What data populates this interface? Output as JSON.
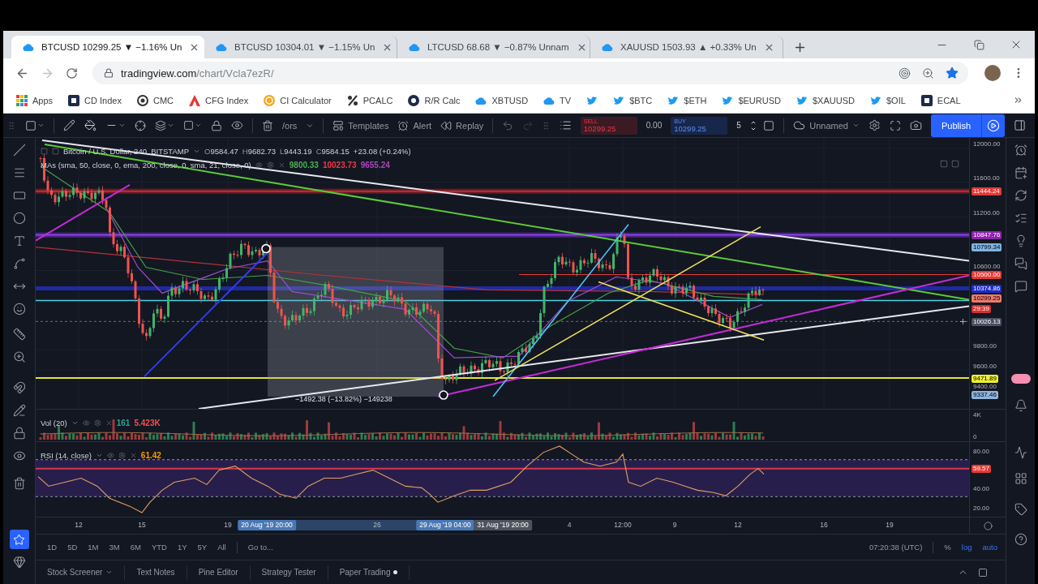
{
  "browser": {
    "tabs": [
      {
        "title": "BTCUSD 10299.25 ▼ −1.16% Un",
        "selected": true
      },
      {
        "title": "BTCUSD 10304.01 ▼ −1.15% Un",
        "selected": false
      },
      {
        "title": "LTCUSD 68.68 ▼ −0.87% Unnam",
        "selected": false
      },
      {
        "title": "XAUUSD 1503.93 ▲ +0.33% Un",
        "selected": false
      }
    ],
    "address": {
      "domain": "tradingview.com",
      "path": "/chart/Vcla7ezR/"
    },
    "bookmarks": [
      {
        "kind": "apps",
        "label": "Apps"
      },
      {
        "kind": "tile",
        "label": "CD Index"
      },
      {
        "kind": "ring",
        "label": "CMC"
      },
      {
        "kind": "triangle",
        "label": "CFG Index"
      },
      {
        "kind": "coin",
        "label": "CI Calculator"
      },
      {
        "kind": "percent",
        "label": "PCALC"
      },
      {
        "kind": "disc",
        "label": "R/R Calc"
      },
      {
        "kind": "cloud",
        "label": "XBTUSD"
      },
      {
        "kind": "cloud",
        "label": "TV"
      },
      {
        "kind": "bird"
      },
      {
        "kind": "bird",
        "label": "$BTC"
      },
      {
        "kind": "bird",
        "label": "$ETH"
      },
      {
        "kind": "bird",
        "label": "$EURUSD"
      },
      {
        "kind": "bird",
        "label": "$XAUUSD"
      },
      {
        "kind": "bird",
        "label": "$OIL"
      },
      {
        "kind": "tile",
        "label": "ECAL"
      }
    ]
  },
  "toolbar": {
    "indicators": "/ors",
    "templates": "Templates",
    "alert": "Alert",
    "replay": "Replay",
    "sell": {
      "label": "SELL",
      "price": "10299.25"
    },
    "spread": "0.00",
    "buy": {
      "label": "BUY",
      "price": "10299.25"
    },
    "quantity": "5",
    "layout": "Unnamed",
    "publish": "Publish"
  },
  "chart": {
    "legend": {
      "symbol": "Bitcoin / U.S. Dollar, 240, BITSTAMP",
      "ohlc": [
        {
          "key": "O",
          "value": "9584.47"
        },
        {
          "key": "H",
          "value": "9682.73"
        },
        {
          "key": "L",
          "value": "9443.19"
        },
        {
          "key": "C",
          "value": "9584.15"
        }
      ],
      "change": "+23.08 (+0.24%)"
    },
    "main_study": {
      "name": "MAs (sma, 50, close, 0, ema, 200, close, 0, sma, 21, close, 0)",
      "values": [
        {
          "text": "9800.33",
          "color": "#4caf50"
        },
        {
          "text": "10023.73",
          "color": "#f23645"
        },
        {
          "text": "9655.24",
          "color": "#ab47bc"
        }
      ]
    },
    "measure": "−1492.38 (−13.82%) −149238",
    "price_axis": {
      "ticks": [
        "12000.00",
        "11600.00",
        "11200.00",
        "10600.00",
        "9800.00",
        "9600.00",
        "9400.00"
      ],
      "markers": [
        {
          "label": "11444.24",
          "color": "#e53935"
        },
        {
          "label": "10847.76",
          "color": "#8e24aa"
        },
        {
          "label": "10799.34",
          "color": "#7fb3e0"
        },
        {
          "label": "10500.00",
          "color": "#e53935"
        },
        {
          "label": "10374.86",
          "color": "#1e2bc8"
        },
        {
          "label": "10299.25",
          "color": "#ef7a6a"
        },
        {
          "label": "29:39",
          "color": "#d32f2f"
        },
        {
          "label": "10026.13",
          "color": "#4a5163"
        },
        {
          "label": "9471.89",
          "color": "#f0f032"
        },
        {
          "label": "9337.46",
          "color": "#8fb6de"
        }
      ]
    },
    "volume": {
      "name": "Vol (20)",
      "values": [
        {
          "text": "161",
          "color": "#26a69a"
        },
        {
          "text": "5.423K",
          "color": "#ef5350"
        }
      ],
      "axis": [
        "4K",
        "0"
      ]
    },
    "rsi": {
      "name": "RSI (14, close)",
      "values": [
        {
          "text": "61.42",
          "color": "#ff9800"
        }
      ],
      "axis": {
        "ticks": [
          "80.00",
          "40.00",
          "20.00"
        ],
        "markers": [
          {
            "label": "59.57",
            "color": "#e53935"
          }
        ]
      }
    },
    "time_axis": [
      {
        "label": "12",
        "kind": "tick"
      },
      {
        "label": "15",
        "kind": "tick"
      },
      {
        "label": "19",
        "kind": "tick"
      },
      {
        "label": "20 Aug '19 20:00",
        "kind": "range"
      },
      {
        "label": "26",
        "kind": "tick"
      },
      {
        "label": "29 Aug '19 04:00",
        "kind": "range"
      },
      {
        "label": "31 Aug '19 20:00",
        "kind": "cursor"
      },
      {
        "label": "4",
        "kind": "tick"
      },
      {
        "label": "12:00",
        "kind": "tick"
      },
      {
        "label": "9",
        "kind": "tick"
      },
      {
        "label": "12",
        "kind": "tick"
      },
      {
        "label": "16",
        "kind": "tick"
      },
      {
        "label": "19",
        "kind": "tick"
      }
    ],
    "range_bar": {
      "ranges": [
        "1D",
        "5D",
        "1M",
        "3M",
        "6M",
        "YTD",
        "1Y",
        "5Y",
        "All"
      ],
      "goto": "Go to...",
      "clock": "07:20:38 (UTC)",
      "toggles": [
        {
          "label": "%",
          "on": false
        },
        {
          "label": "log",
          "on": true
        },
        {
          "label": "auto",
          "on": true
        }
      ]
    }
  },
  "bottom_tabs": [
    {
      "label": "Stock Screener",
      "kind": "menu"
    },
    {
      "label": "Text Notes",
      "kind": "plain"
    },
    {
      "label": "Pine Editor",
      "kind": "plain"
    },
    {
      "label": "Strategy Tester",
      "kind": "plain"
    },
    {
      "label": "Paper Trading",
      "kind": "status"
    }
  ]
}
